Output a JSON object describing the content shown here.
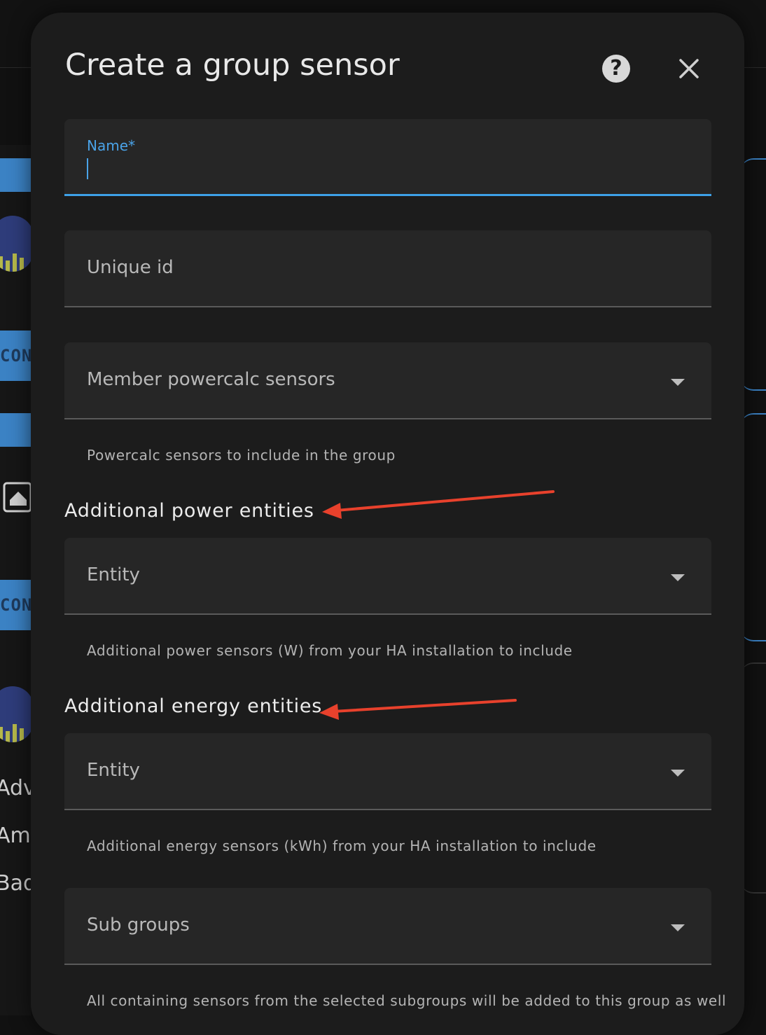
{
  "dialog": {
    "title": "Create a group sensor",
    "help_icon": "help-circle-icon",
    "close_icon": "close-icon"
  },
  "fields": {
    "name": {
      "label": "Name*",
      "value": ""
    },
    "unique_id": {
      "placeholder": "Unique id"
    },
    "member_sensors": {
      "label": "Member powercalc sensors",
      "helper": "Powercalc sensors to include in the group"
    },
    "power_entities": {
      "section_title": "Additional power entities",
      "label": "Entity",
      "helper": "Additional power sensors (W) from your HA installation to include"
    },
    "energy_entities": {
      "section_title": "Additional energy entities",
      "label": "Entity",
      "helper": "Additional energy sensors (kWh) from your HA installation to include"
    },
    "sub_groups": {
      "label": "Sub groups",
      "helper": "All containing sensors from the selected subgroups will be added to this group as well"
    }
  },
  "background": {
    "con_label_1": "CON",
    "con_label_2": "CON",
    "side_text_1": "Adva",
    "side_text_2": "Amb",
    "side_text_3": "Badi"
  },
  "colors": {
    "accent": "#3ea1e8",
    "annotation_arrow": "#e8412c",
    "dialog_bg": "#1c1c1c",
    "field_bg": "#262626"
  }
}
